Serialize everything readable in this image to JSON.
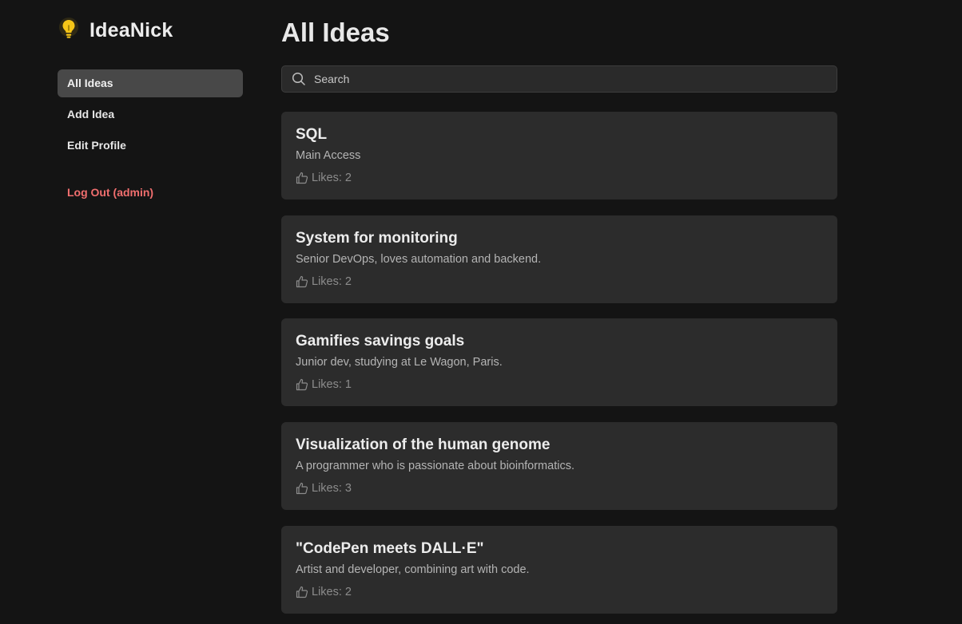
{
  "app": {
    "name": "IdeaNick"
  },
  "sidebar": {
    "items": [
      {
        "label": "All Ideas"
      },
      {
        "label": "Add Idea"
      },
      {
        "label": "Edit Profile"
      }
    ],
    "logout_label": "Log Out (admin)"
  },
  "main": {
    "title": "All Ideas",
    "search": {
      "placeholder": "Search",
      "value": ""
    },
    "ideas": [
      {
        "title": "SQL",
        "description": "Main Access",
        "likes": "Likes: 2"
      },
      {
        "title": "System for monitoring",
        "description": "Senior DevOps, loves automation and backend.",
        "likes": "Likes: 2"
      },
      {
        "title": "Gamifies savings goals",
        "description": "Junior dev, studying at Le Wagon, Paris.",
        "likes": "Likes: 1"
      },
      {
        "title": "Visualization of the human genome",
        "description": "A programmer who is passionate about bioinformatics.",
        "likes": "Likes: 3"
      },
      {
        "title": "\"CodePen meets DALL·E\"",
        "description": "Artist and developer, combining art with code.",
        "likes": "Likes: 2"
      }
    ]
  },
  "icons": {
    "brand": "lightbulb-icon",
    "search": "search-icon",
    "like": "thumbs-up-icon"
  },
  "colors": {
    "background": "#141414",
    "card": "#2c2c2c",
    "active_nav": "#484848",
    "logout": "#f06e6e",
    "brand_icon": "#f5c518"
  }
}
